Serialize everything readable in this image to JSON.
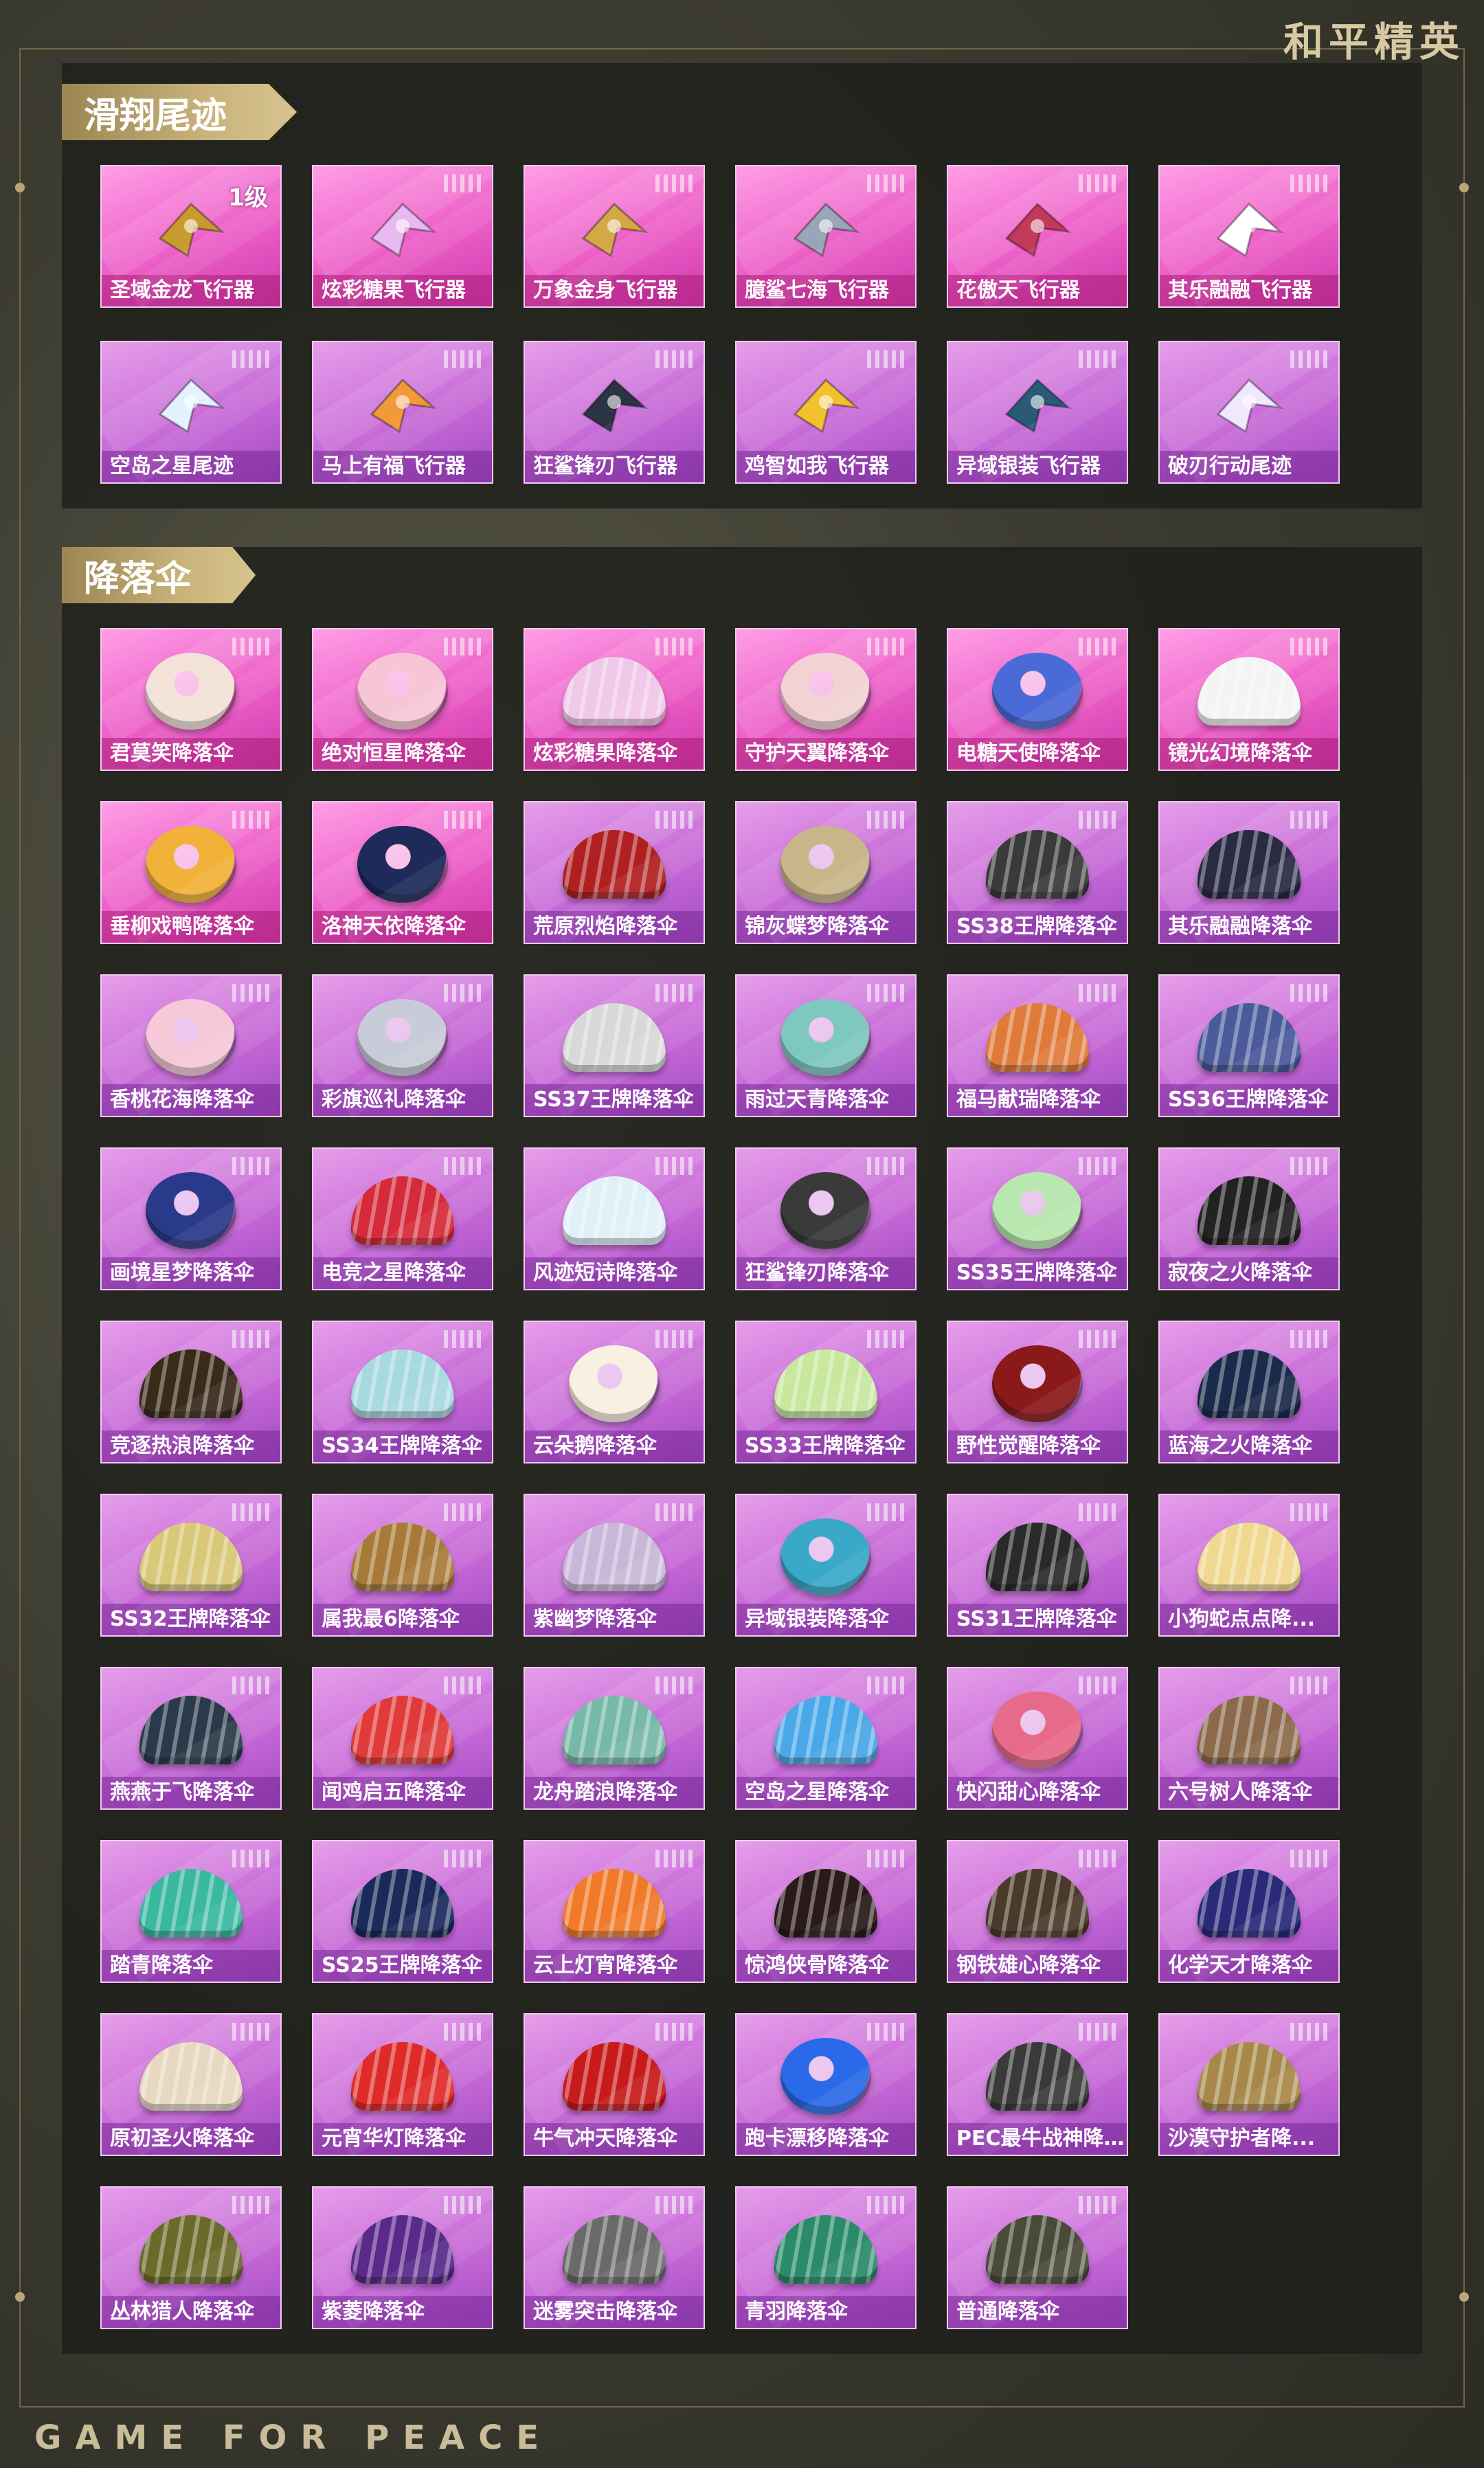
{
  "brand": "和平精英",
  "footer": "GAME FOR PEACE",
  "sections": [
    {
      "title": "滑翔尾迹",
      "items": [
        {
          "name": "圣域金龙飞行器",
          "level": "1级",
          "style": "pink",
          "art": "craft",
          "color": "#c99a2e"
        },
        {
          "name": "炫彩糖果飞行器",
          "style": "pink",
          "art": "craft",
          "color": "#e8b8f0"
        },
        {
          "name": "万象金身飞行器",
          "style": "pink",
          "art": "craft",
          "color": "#d4a845"
        },
        {
          "name": "臆鲨七海飞行器",
          "style": "pink",
          "art": "craft",
          "color": "#9aa6b8"
        },
        {
          "name": "花傲天飞行器",
          "style": "pink",
          "art": "craft",
          "color": "#c23a5a"
        },
        {
          "name": "其乐融融飞行器",
          "style": "pink",
          "art": "craft",
          "color": "#ffffff"
        },
        {
          "name": "空岛之星尾迹",
          "style": "purple",
          "art": "craft",
          "color": "#e4f2ff"
        },
        {
          "name": "马上有福飞行器",
          "style": "purple",
          "art": "craft",
          "color": "#f29a3a"
        },
        {
          "name": "狂鲨锋刃飞行器",
          "style": "purple",
          "art": "craft",
          "color": "#2a3442"
        },
        {
          "name": "鸡智如我飞行器",
          "style": "purple",
          "art": "craft",
          "color": "#f2c12e"
        },
        {
          "name": "异域银装飞行器",
          "style": "purple",
          "art": "craft",
          "color": "#2a5a78"
        },
        {
          "name": "破刃行动尾迹",
          "style": "purple",
          "art": "craft",
          "color": "#f0e8ff"
        }
      ]
    },
    {
      "title": "降落伞",
      "items": [
        {
          "name": "君莫笑降落伞",
          "style": "pink",
          "art": "round",
          "color": "#f2e2d8"
        },
        {
          "name": "绝对恒星降落伞",
          "style": "pink",
          "art": "round",
          "color": "#f6c6d6"
        },
        {
          "name": "炫彩糖果降落伞",
          "style": "pink",
          "art": "dome",
          "color": "#f0c8e8"
        },
        {
          "name": "守护天翼降落伞",
          "style": "pink",
          "art": "round",
          "color": "#f2d2d2"
        },
        {
          "name": "电糖天使降落伞",
          "style": "pink",
          "art": "round",
          "color": "#4a6ad8"
        },
        {
          "name": "镜光幻境降落伞",
          "style": "pink",
          "art": "dome",
          "color": "#f4f4f4"
        },
        {
          "name": "垂柳戏鸭降落伞",
          "style": "pink",
          "art": "round",
          "color": "#f2b23a"
        },
        {
          "name": "洛神天依降落伞",
          "style": "pink",
          "art": "round",
          "color": "#1e2a5a"
        },
        {
          "name": "荒原烈焰降落伞",
          "style": "purple",
          "art": "dome",
          "color": "#b02020"
        },
        {
          "name": "锦灰蝶梦降落伞",
          "style": "purple",
          "art": "round",
          "color": "#c9b58a"
        },
        {
          "name": "SS38王牌降落伞",
          "style": "purple",
          "art": "dome",
          "color": "#3a3a3a"
        },
        {
          "name": "其乐融融降落伞",
          "style": "purple",
          "art": "dome",
          "color": "#2a2a44"
        },
        {
          "name": "香桃花海降落伞",
          "style": "purple",
          "art": "round",
          "color": "#f6c8d8"
        },
        {
          "name": "彩旗巡礼降落伞",
          "style": "purple",
          "art": "round",
          "color": "#c8ccd8"
        },
        {
          "name": "SS37王牌降落伞",
          "style": "purple",
          "art": "dome",
          "color": "#d8d8d8"
        },
        {
          "name": "雨过天青降落伞",
          "style": "purple",
          "art": "round",
          "color": "#7ec8c0"
        },
        {
          "name": "福马献瑞降落伞",
          "style": "purple",
          "art": "dome",
          "color": "#e07a3a"
        },
        {
          "name": "SS36王牌降落伞",
          "style": "purple",
          "art": "dome",
          "color": "#4a5a9a"
        },
        {
          "name": "画境星梦降落伞",
          "style": "purple",
          "art": "round",
          "color": "#2a3a8a"
        },
        {
          "name": "电竞之星降落伞",
          "style": "purple",
          "art": "dome",
          "color": "#d42a3a"
        },
        {
          "name": "风迹短诗降落伞",
          "style": "purple",
          "art": "dome",
          "color": "#e0f0f8"
        },
        {
          "name": "狂鲨锋刃降落伞",
          "style": "purple",
          "art": "round",
          "color": "#3a3a3a"
        },
        {
          "name": "SS35王牌降落伞",
          "style": "purple",
          "art": "round",
          "color": "#b8e8b0"
        },
        {
          "name": "寂夜之火降落伞",
          "style": "purple",
          "art": "dome",
          "color": "#222222"
        },
        {
          "name": "竞逐热浪降落伞",
          "style": "purple",
          "art": "dome",
          "color": "#3a2a1a"
        },
        {
          "name": "SS34王牌降落伞",
          "style": "purple",
          "art": "dome",
          "color": "#a8d8e0"
        },
        {
          "name": "云朵鹅降落伞",
          "style": "purple",
          "art": "round",
          "color": "#f8f0e0"
        },
        {
          "name": "SS33王牌降落伞",
          "style": "purple",
          "art": "dome",
          "color": "#c8e8a0"
        },
        {
          "name": "野性觉醒降落伞",
          "style": "purple",
          "art": "round",
          "color": "#8a1a1a"
        },
        {
          "name": "蓝海之火降落伞",
          "style": "purple",
          "art": "dome",
          "color": "#1a2a4a"
        },
        {
          "name": "SS32王牌降落伞",
          "style": "purple",
          "art": "dome",
          "color": "#d8c878"
        },
        {
          "name": "属我最6降落伞",
          "style": "purple",
          "art": "dome",
          "color": "#a87a3a"
        },
        {
          "name": "紫幽梦降落伞",
          "style": "purple",
          "art": "dome",
          "color": "#c8b8d8"
        },
        {
          "name": "异域银装降落伞",
          "style": "purple",
          "art": "round",
          "color": "#3aa8c8"
        },
        {
          "name": "SS31王牌降落伞",
          "style": "purple",
          "art": "dome",
          "color": "#2a2a2a"
        },
        {
          "name": "小狗蛇点点降...",
          "style": "purple",
          "art": "dome",
          "color": "#f0d890"
        },
        {
          "name": "燕燕于飞降落伞",
          "style": "purple",
          "art": "dome",
          "color": "#2a3a4a"
        },
        {
          "name": "闻鸡启五降落伞",
          "style": "purple",
          "art": "dome",
          "color": "#e03a3a"
        },
        {
          "name": "龙舟踏浪降落伞",
          "style": "purple",
          "art": "dome",
          "color": "#78b8a8"
        },
        {
          "name": "空岛之星降落伞",
          "style": "purple",
          "art": "dome",
          "color": "#4aa8e8"
        },
        {
          "name": "快闪甜心降落伞",
          "style": "purple",
          "art": "round",
          "color": "#e86a8a"
        },
        {
          "name": "六号树人降落伞",
          "style": "purple",
          "art": "dome",
          "color": "#8a6a4a"
        },
        {
          "name": "踏青降落伞",
          "style": "purple",
          "art": "dome",
          "color": "#3ab8a0"
        },
        {
          "name": "SS25王牌降落伞",
          "style": "purple",
          "art": "dome",
          "color": "#1a2a5a"
        },
        {
          "name": "云上灯宵降落伞",
          "style": "purple",
          "art": "dome",
          "color": "#f07a2a"
        },
        {
          "name": "惊鸿侠骨降落伞",
          "style": "purple",
          "art": "dome",
          "color": "#2a1a1a"
        },
        {
          "name": "钢铁雄心降落伞",
          "style": "purple",
          "art": "dome",
          "color": "#4a3a2a"
        },
        {
          "name": "化学天才降落伞",
          "style": "purple",
          "art": "dome",
          "color": "#2a2a7a"
        },
        {
          "name": "原初圣火降落伞",
          "style": "purple",
          "art": "dome",
          "color": "#e8d8c0"
        },
        {
          "name": "元宵华灯降落伞",
          "style": "purple",
          "art": "dome",
          "color": "#e02a2a"
        },
        {
          "name": "牛气冲天降落伞",
          "style": "purple",
          "art": "dome",
          "color": "#c81a1a"
        },
        {
          "name": "跑卡漂移降落伞",
          "style": "purple",
          "art": "round",
          "color": "#2a6ae8"
        },
        {
          "name": "PEC最牛战神降...",
          "style": "purple",
          "art": "dome",
          "color": "#3a3a3a"
        },
        {
          "name": "沙漠守护者降...",
          "style": "purple",
          "art": "dome",
          "color": "#a8884a"
        },
        {
          "name": "丛林猎人降落伞",
          "style": "purple",
          "art": "dome",
          "color": "#6a6a2a"
        },
        {
          "name": "紫菱降落伞",
          "style": "purple",
          "art": "dome",
          "color": "#5a2a8a"
        },
        {
          "name": "迷雾突击降落伞",
          "style": "purple",
          "art": "dome",
          "color": "#6a6a6a"
        },
        {
          "name": "青羽降落伞",
          "style": "purple",
          "art": "dome",
          "color": "#2a8a6a"
        },
        {
          "name": "普通降落伞",
          "style": "purple",
          "art": "dome",
          "color": "#4a4a3a"
        }
      ]
    }
  ]
}
